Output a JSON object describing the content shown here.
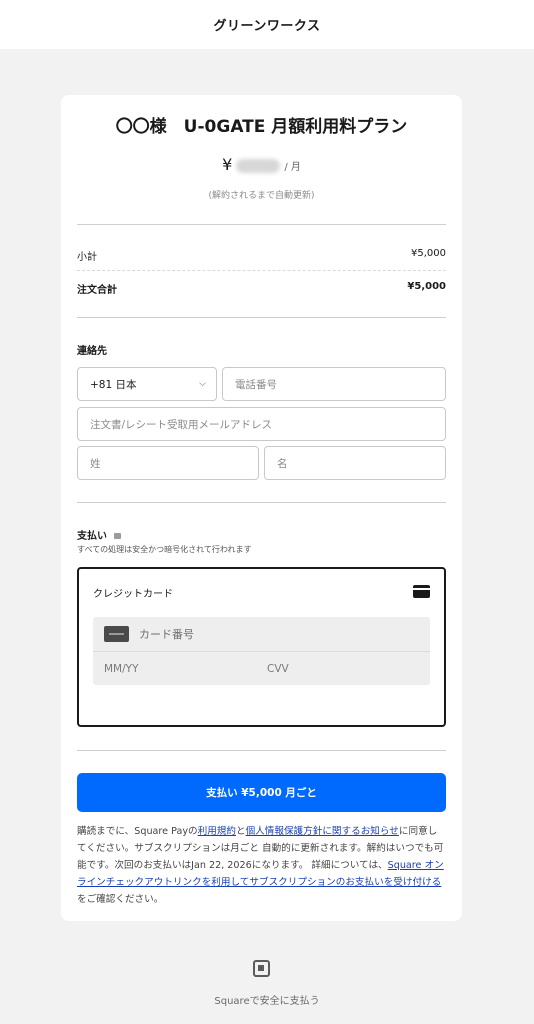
{
  "header": {
    "merchant_name": "グリーンワークス"
  },
  "plan": {
    "title": "〇〇様　U-0GATE 月額利用料プラン",
    "currency_symbol": "¥",
    "per_label": "/ 月",
    "auto_renew_note": "(解約されるまで自動更新)"
  },
  "summary": {
    "subtotal_label": "小計",
    "subtotal_value": "¥5,000",
    "total_label": "注文合計",
    "total_value": "¥5,000"
  },
  "contact": {
    "section_title": "連絡先",
    "country_value": "+81 日本",
    "phone_placeholder": "電話番号",
    "email_placeholder": "注文書/レシート受取用メールアドレス",
    "last_name_placeholder": "姓",
    "first_name_placeholder": "名"
  },
  "payment": {
    "section_title": "支払い",
    "secure_note": "すべての処理は安全かつ暗号化されて行われます",
    "method_label": "クレジットカード",
    "card_number_placeholder": "カード番号",
    "expiry_placeholder": "MM/YY",
    "cvv_placeholder": "CVV",
    "pay_button_label": "支払い ¥5,000 月ごと"
  },
  "terms": {
    "t1": "購読までに、Square Payの",
    "link1": "利用規約",
    "t2": "と",
    "link2": "個人情報保護方針に関するお知らせ",
    "t3": "に同意してください。サブスクリプションは月ごと 自動的に更新されます。解約はいつでも可能です。次回のお支払いはJan 22, 2026になります。 詳細については、",
    "link3": "Square オンラインチェックアウトリンクを利用してサブスクリプションのお支払いを受け付ける",
    "t4": "をご確認ください。"
  },
  "footer": {
    "text": "Squareで安全に支払う"
  },
  "icons": {
    "credit_card": "credit-card-icon",
    "lock": "lock-icon",
    "chevron": "chevron-down-icon",
    "square_logo": "square-logo-icon"
  },
  "colors": {
    "accent": "#006aff",
    "link": "#1a3fb8"
  }
}
